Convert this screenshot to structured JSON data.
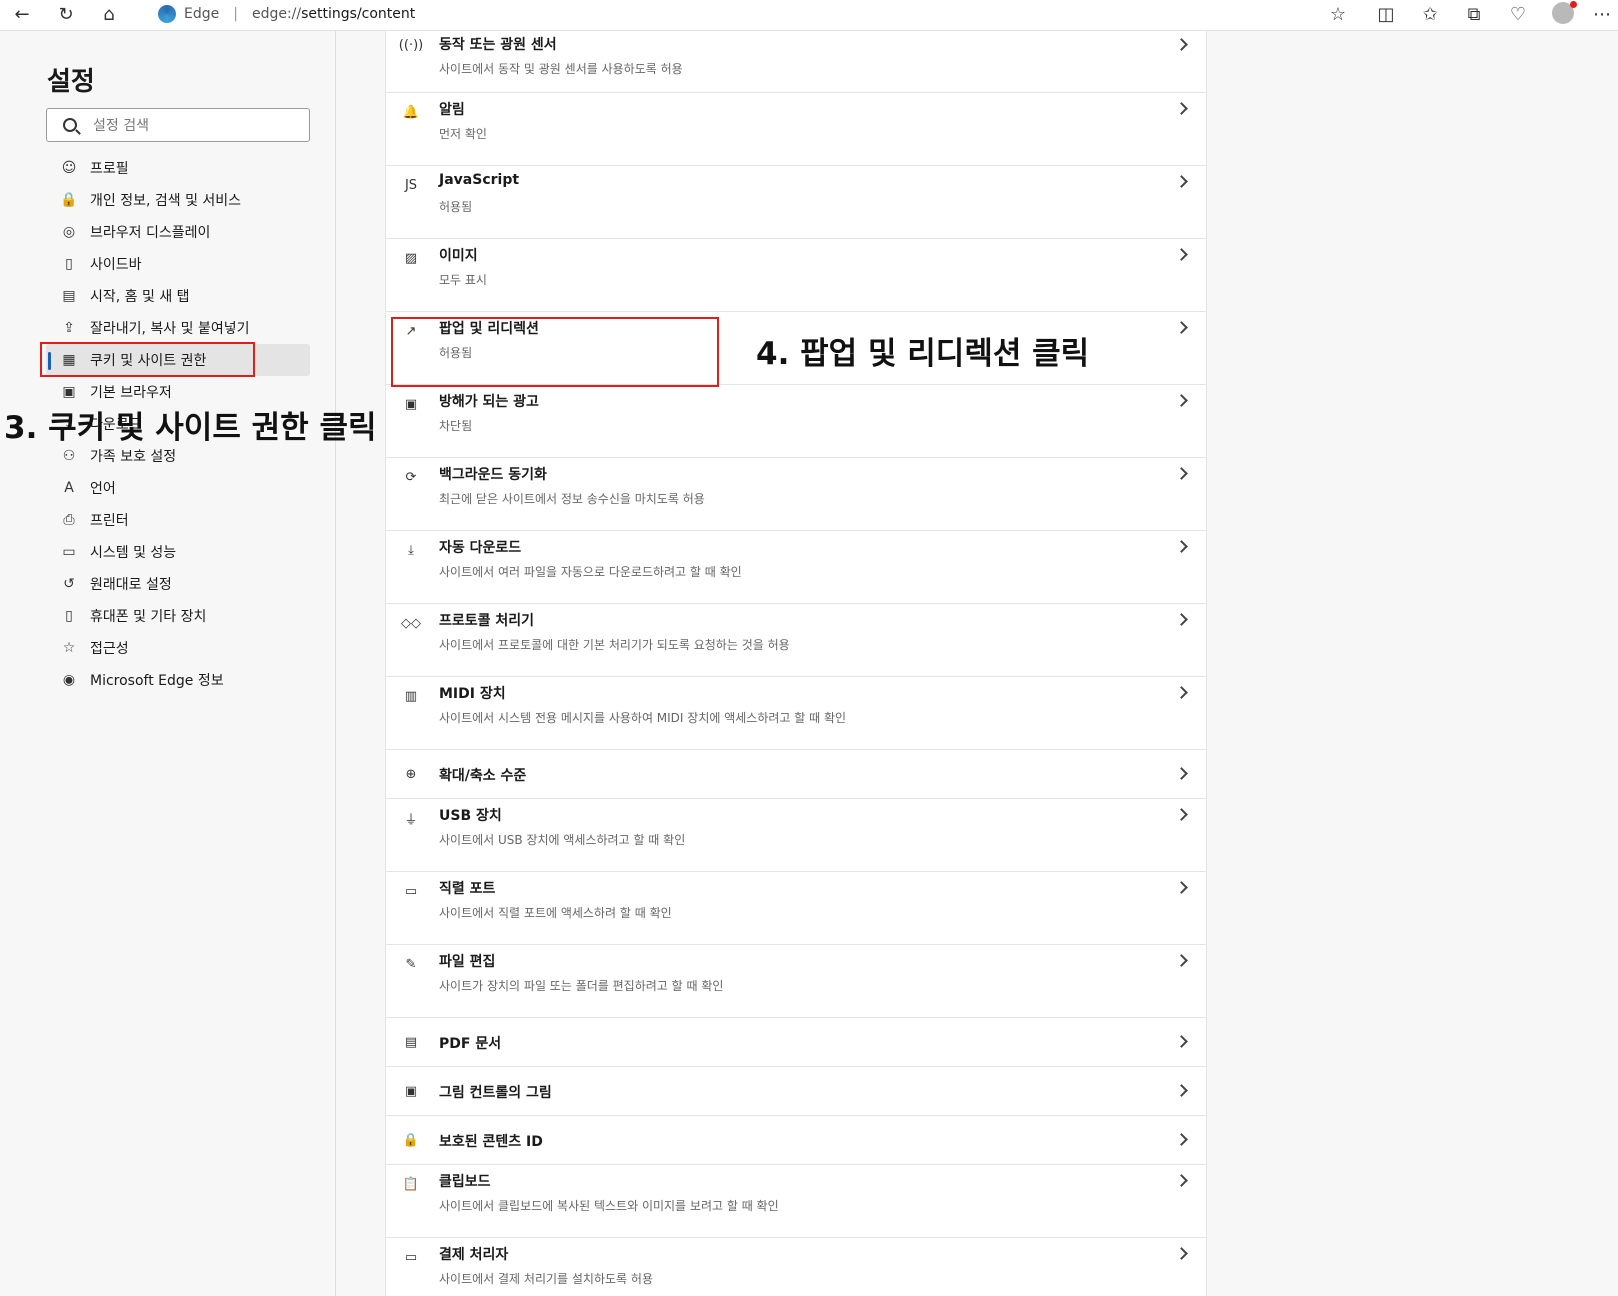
{
  "browser": {
    "app_name": "Edge",
    "url": "edge://settings/content",
    "url_prefix": "edge://",
    "url_rest": "settings/content"
  },
  "sidebar": {
    "title": "설정",
    "search_placeholder": "설정 검색",
    "items": [
      {
        "label": "프로필",
        "icon": "profile-icon"
      },
      {
        "label": "개인 정보, 검색 및 서비스",
        "icon": "lock-icon"
      },
      {
        "label": "브라우저 디스플레이",
        "icon": "palette-icon"
      },
      {
        "label": "사이드바",
        "icon": "sidebar-icon"
      },
      {
        "label": "시작, 홈 및 새 탭",
        "icon": "home-tab-icon"
      },
      {
        "label": "잘라내기, 복사 및 붙여넣기",
        "icon": "share-icon"
      },
      {
        "label": "쿠키 및 사이트 권한",
        "icon": "cookie-icon",
        "active": true
      },
      {
        "label": "기본 브라우저",
        "icon": "browser-icon"
      },
      {
        "label": "다운로드",
        "icon": "download-icon"
      },
      {
        "label": "가족 보호 설정",
        "icon": "family-icon"
      },
      {
        "label": "언어",
        "icon": "language-icon"
      },
      {
        "label": "프린터",
        "icon": "printer-icon"
      },
      {
        "label": "시스템 및 성능",
        "icon": "laptop-icon"
      },
      {
        "label": "원래대로 설정",
        "icon": "reset-icon"
      },
      {
        "label": "휴대폰 및 기타 장치",
        "icon": "phone-icon"
      },
      {
        "label": "접근성",
        "icon": "accessibility-icon"
      },
      {
        "label": "Microsoft Edge 정보",
        "icon": "edge-icon"
      }
    ]
  },
  "annotations": {
    "step3": "3. 쿠키 및 사이트 권한 클릭",
    "step4": "4. 팝업 및 리디렉션 클릭"
  },
  "content": {
    "rows": [
      {
        "title": "동작 또는 광원 센서",
        "subtitle": "사이트에서 동작 및 광원 센서를 사용하도록 허용",
        "icon": "sensor-icon",
        "glyph": "((·))"
      },
      {
        "title": "알림",
        "subtitle": "먼저 확인",
        "icon": "bell-icon",
        "glyph": "🔔"
      },
      {
        "title": "JavaScript",
        "subtitle": "허용됨",
        "icon": "javascript-icon",
        "glyph": "JS"
      },
      {
        "title": "이미지",
        "subtitle": "모두 표시",
        "icon": "image-icon",
        "glyph": "▨"
      },
      {
        "title": "팝업 및 리디렉션",
        "subtitle": "허용됨",
        "icon": "popup-icon",
        "glyph": "↗"
      },
      {
        "title": "방해가 되는 광고",
        "subtitle": "차단됨",
        "icon": "ads-icon",
        "glyph": "▣"
      },
      {
        "title": "백그라운드 동기화",
        "subtitle": "최근에 닫은 사이트에서 정보 송수신을 마치도록 허용",
        "icon": "sync-icon",
        "glyph": "⟳"
      },
      {
        "title": "자동 다운로드",
        "subtitle": "사이트에서 여러 파일을 자동으로 다운로드하려고 할 때 확인",
        "icon": "download-icon",
        "glyph": "⤓"
      },
      {
        "title": "프로토콜 처리기",
        "subtitle": "사이트에서 프로토콜에 대한 기본 처리기가 되도록 요청하는 것을 허용",
        "icon": "protocol-icon",
        "glyph": "◇◇"
      },
      {
        "title": "MIDI 장치",
        "subtitle": "사이트에서 시스템 전용 메시지를 사용하여 MIDI 장치에 액세스하려고 할 때 확인",
        "icon": "midi-icon",
        "glyph": "▥"
      },
      {
        "title": "확대/축소 수준",
        "subtitle": "",
        "icon": "zoom-icon",
        "glyph": "⊕"
      },
      {
        "title": "USB 장치",
        "subtitle": "사이트에서 USB 장치에 액세스하려고 할 때 확인",
        "icon": "usb-icon",
        "glyph": "⏚"
      },
      {
        "title": "직렬 포트",
        "subtitle": "사이트에서 직렬 포트에 액세스하려 할 때 확인",
        "icon": "serial-icon",
        "glyph": "▭"
      },
      {
        "title": "파일 편집",
        "subtitle": "사이트가 장치의 파일 또는 폴더를 편집하려고 할 때 확인",
        "icon": "file-edit-icon",
        "glyph": "✎"
      },
      {
        "title": "PDF 문서",
        "subtitle": "",
        "icon": "pdf-icon",
        "glyph": "▤"
      },
      {
        "title": "그림 컨트롤의 그림",
        "subtitle": "",
        "icon": "pip-icon",
        "glyph": "▣"
      },
      {
        "title": "보호된 콘텐츠 ID",
        "subtitle": "",
        "icon": "protected-icon",
        "glyph": "🔒"
      },
      {
        "title": "클립보드",
        "subtitle": "사이트에서 클립보드에 복사된 텍스트와 이미지를 보려고 할 때 확인",
        "icon": "clipboard-icon",
        "glyph": "📋"
      },
      {
        "title": "결제 처리자",
        "subtitle": "사이트에서 결제 처리기를 설치하도록 허용",
        "icon": "payment-icon",
        "glyph": "▭"
      }
    ]
  },
  "colors": {
    "highlight_box": "#e01e1e",
    "active_indicator": "#1a5fb4"
  }
}
